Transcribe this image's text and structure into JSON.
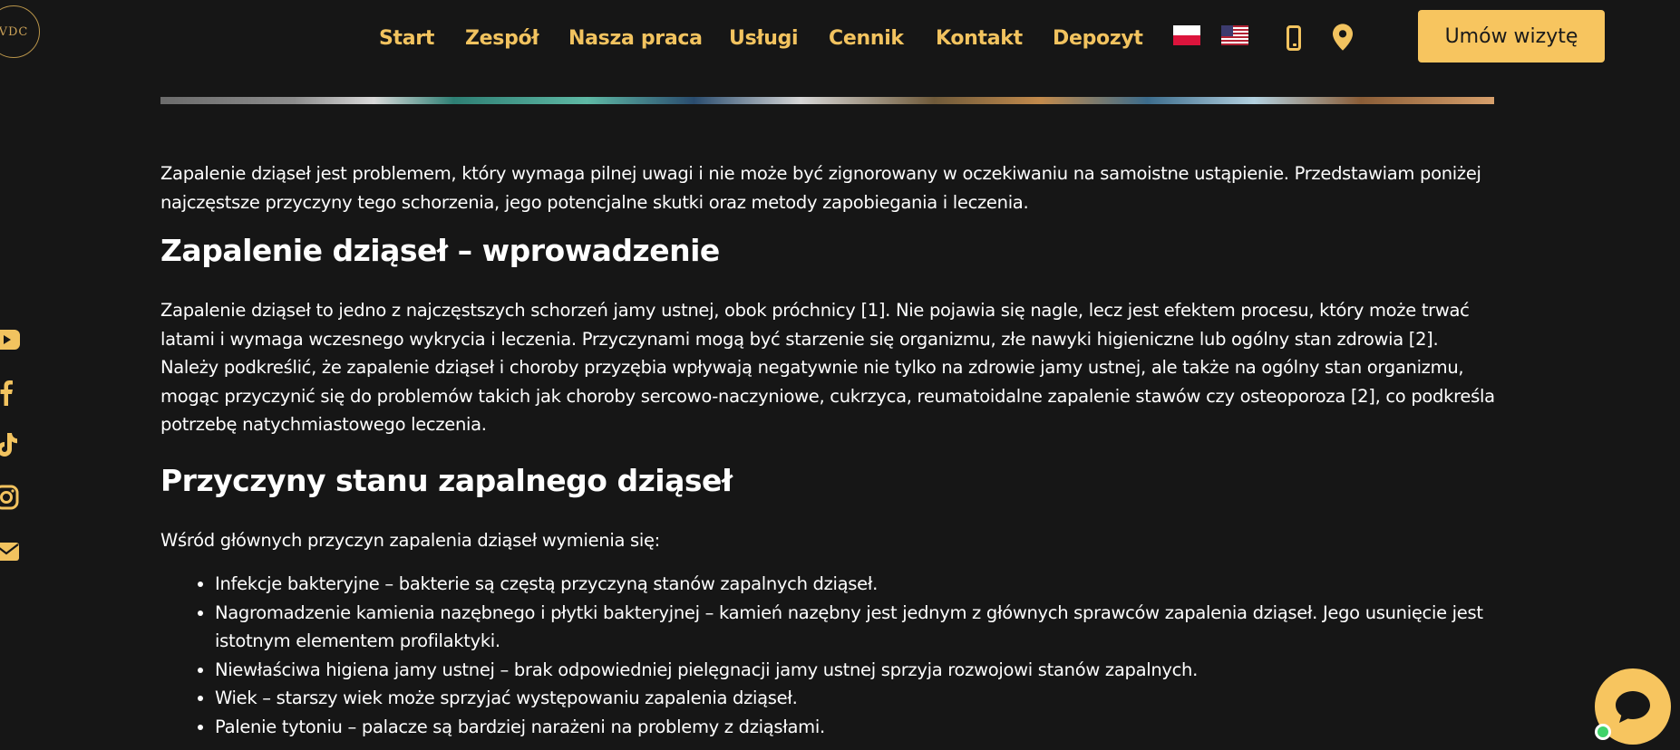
{
  "logo": {
    "text": "VDC"
  },
  "nav": {
    "items": [
      {
        "label": "Start"
      },
      {
        "label": "Zespół"
      },
      {
        "label": "Nasza praca"
      },
      {
        "label": "Usługi"
      },
      {
        "label": "Cennik"
      },
      {
        "label": "Kontakt"
      },
      {
        "label": "Depozyt"
      }
    ],
    "languages": [
      "pl-flag-icon",
      "us-flag-icon"
    ],
    "icons": [
      "phone-icon",
      "map-pin-icon"
    ],
    "cta_label": "Umów wizytę",
    "accent_color": "#f7c55f"
  },
  "content": {
    "intro": "Zapalenie dziąseł jest problemem, który wymaga pilnej uwagi i nie może być zignorowany w oczekiwaniu na samoistne ustąpienie. Przedstawiam poniżej najczęstsze przyczyny tego schorzenia, jego potencjalne skutki oraz metody zapobiegania i leczenia.",
    "heading1": "Zapalenie dziąseł – wprowadzenie",
    "para1": "Zapalenie dziąseł to jedno z najczęstszych schorzeń jamy ustnej, obok próchnicy [1]. Nie pojawia się nagle, lecz jest efektem procesu, który może trwać latami i wymaga wczesnego wykrycia i leczenia. Przyczynami mogą być starzenie się organizmu, złe nawyki higieniczne lub ogólny stan zdrowia [2]. Należy podkreślić, że zapalenie dziąseł i choroby przyzębia wpływają negatywnie nie tylko na zdrowie jamy ustnej, ale także na ogólny stan organizmu, mogąc przyczynić się do problemów takich jak choroby sercowo-naczyniowe, cukrzyca, reumatoidalne zapalenie stawów czy osteoporoza [2], co podkreśla potrzebę natychmiastowego leczenia.",
    "heading2": "Przyczyny stanu zapalnego dziąseł",
    "para2": "Wśród głównych przyczyn zapalenia dziąseł wymienia się:",
    "causes": [
      "Infekcje bakteryjne – bakterie są częstą przyczyną stanów zapalnych dziąseł.",
      "Nagromadzenie kamienia nazębnego i płytki bakteryjnej – kamień nazębny jest jednym z głównych sprawców zapalenia dziąseł. Jego usunięcie jest istotnym elementem profilaktyki.",
      "Niewłaściwa higiena jamy ustnej – brak odpowiedniej pielęgnacji jamy ustnej sprzyja rozwojowi stanów zapalnych.",
      "Wiek – starszy wiek może sprzyjać występowaniu zapalenia dziąseł.",
      "Palenie tytoniu – palacze są bardziej narażeni na problemy z dziąsłami."
    ]
  },
  "social": [
    "youtube-icon",
    "facebook-icon",
    "tiktok-icon",
    "instagram-icon",
    "email-icon"
  ],
  "chat": {
    "icon": "chat-bubble-icon",
    "status_color": "#3fd36a"
  }
}
